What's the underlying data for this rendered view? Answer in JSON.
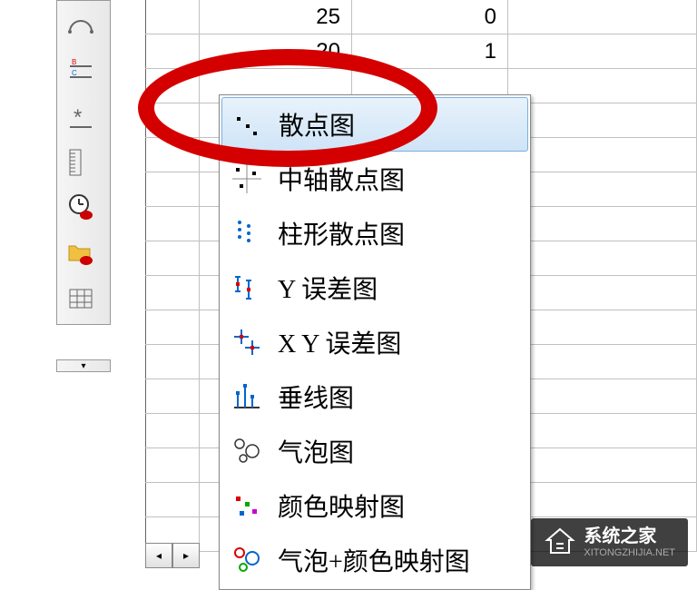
{
  "grid": {
    "rows": [
      {
        "b": "25",
        "c": "0"
      },
      {
        "b": "20",
        "c": "1"
      },
      {
        "b": "",
        "c": ""
      },
      {
        "b": "",
        "c": ""
      }
    ]
  },
  "menu": {
    "items": [
      {
        "label": "散点图",
        "icon": "scatter"
      },
      {
        "label": "中轴散点图",
        "icon": "axis-scatter"
      },
      {
        "label": "柱形散点图",
        "icon": "column-scatter"
      },
      {
        "label": "Y 误差图",
        "icon": "y-error"
      },
      {
        "label": "X Y 误差图",
        "icon": "xy-error"
      },
      {
        "label": "垂线图",
        "icon": "drop-line"
      },
      {
        "label": "气泡图",
        "icon": "bubble"
      },
      {
        "label": "颜色映射图",
        "icon": "color-map"
      },
      {
        "label": "气泡+颜色映射图",
        "icon": "bubble-color"
      }
    ]
  },
  "scroll": {
    "left": "◂",
    "right": "▸"
  },
  "overflow": "▾",
  "watermark": {
    "title": "系统之家",
    "sub": "XITONGZHIJIA.NET"
  }
}
